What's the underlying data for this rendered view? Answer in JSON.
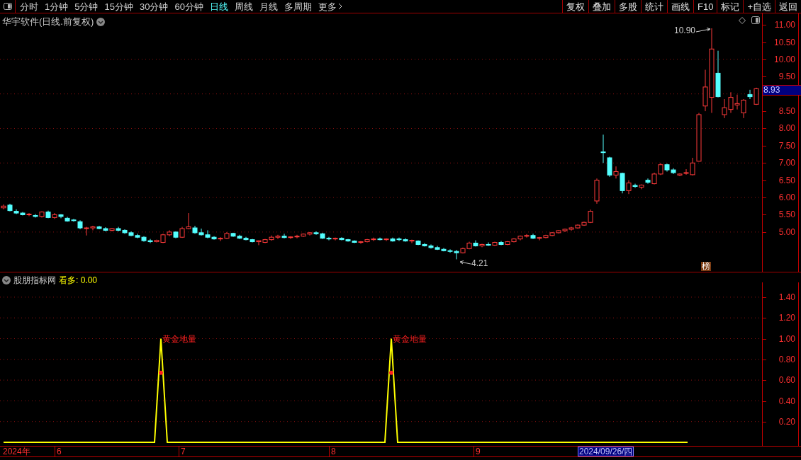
{
  "toolbar": {
    "periods": [
      {
        "label": "分时",
        "kind": "period",
        "selected": false
      },
      {
        "label": "1分钟",
        "kind": "period",
        "selected": false
      },
      {
        "label": "5分钟",
        "kind": "period",
        "selected": false
      },
      {
        "label": "15分钟",
        "kind": "period",
        "selected": false
      },
      {
        "label": "30分钟",
        "kind": "period",
        "selected": false
      },
      {
        "label": "60分钟",
        "kind": "period",
        "selected": false
      },
      {
        "label": "日线",
        "kind": "period",
        "selected": true
      },
      {
        "label": "周线",
        "kind": "period",
        "selected": false
      },
      {
        "label": "月线",
        "kind": "period",
        "selected": false
      },
      {
        "label": "多周期",
        "kind": "period",
        "selected": false
      },
      {
        "label": "更多",
        "kind": "menu",
        "selected": false
      }
    ],
    "buttons": [
      "复权",
      "叠加",
      "多股",
      "统计",
      "画线",
      "F10",
      "标记",
      "+自选",
      "返回"
    ]
  },
  "chart": {
    "title": "华宇软件(日线.前复权)",
    "current_price": "8.93",
    "high_label": "10.90",
    "low_label": "4.21",
    "badge": "榜",
    "chart_data": {
      "type": "candlestick",
      "grid": true,
      "ylim": [
        3.85,
        11.33
      ],
      "yticks": [
        {
          "value": 11,
          "label": "11.00"
        },
        {
          "value": 10.5,
          "label": "10.50"
        },
        {
          "value": 10,
          "label": "10.00"
        },
        {
          "value": 9.5,
          "label": "9.50"
        },
        {
          "value": 8.5,
          "label": "8.50"
        },
        {
          "value": 8,
          "label": "8.00"
        },
        {
          "value": 7.5,
          "label": "7.50"
        },
        {
          "value": 7,
          "label": "7.00"
        },
        {
          "value": 6.5,
          "label": "6.50"
        },
        {
          "value": 6,
          "label": "6.00"
        },
        {
          "value": 5.5,
          "label": "5.50"
        },
        {
          "value": 5,
          "label": "5.00"
        }
      ],
      "ohlc": [
        [
          5.7,
          5.8,
          5.66,
          5.75
        ],
        [
          5.78,
          5.82,
          5.6,
          5.62
        ],
        [
          5.6,
          5.66,
          5.52,
          5.55
        ],
        [
          5.55,
          5.58,
          5.48,
          5.5
        ],
        [
          5.5,
          5.55,
          5.46,
          5.52
        ],
        [
          5.48,
          5.52,
          5.42,
          5.45
        ],
        [
          5.45,
          5.6,
          5.42,
          5.58
        ],
        [
          5.58,
          5.62,
          5.4,
          5.42
        ],
        [
          5.42,
          5.55,
          5.38,
          5.5
        ],
        [
          5.5,
          5.52,
          5.4,
          5.45
        ],
        [
          5.4,
          5.44,
          5.3,
          5.32
        ],
        [
          5.35,
          5.38,
          5.3,
          5.34
        ],
        [
          5.3,
          5.34,
          5.08,
          5.12
        ],
        [
          5.1,
          5.15,
          4.9,
          5.12
        ],
        [
          5.12,
          5.18,
          5.05,
          5.15
        ],
        [
          5.15,
          5.18,
          5.08,
          5.1
        ],
        [
          5.1,
          5.14,
          5.02,
          5.05
        ],
        [
          5.05,
          5.12,
          5.02,
          5.1
        ],
        [
          5.1,
          5.15,
          5.02,
          5.05
        ],
        [
          5.05,
          5.08,
          4.95,
          4.98
        ],
        [
          4.98,
          5.02,
          4.88,
          4.9
        ],
        [
          4.9,
          4.95,
          4.82,
          4.85
        ],
        [
          4.85,
          4.88,
          4.72,
          4.75
        ],
        [
          4.75,
          4.8,
          4.68,
          4.72
        ],
        [
          4.72,
          4.78,
          4.7,
          4.76
        ],
        [
          4.7,
          4.95,
          4.68,
          4.92
        ],
        [
          4.92,
          5.05,
          4.88,
          5.0
        ],
        [
          5.0,
          5.02,
          4.82,
          4.85
        ],
        [
          4.85,
          5.15,
          4.83,
          5.1
        ],
        [
          5.1,
          5.55,
          5.08,
          5.15
        ],
        [
          5.12,
          5.18,
          4.95,
          4.98
        ],
        [
          4.98,
          5.1,
          4.9,
          4.92
        ],
        [
          4.92,
          5.05,
          4.82,
          4.85
        ],
        [
          4.85,
          4.88,
          4.78,
          4.8
        ],
        [
          4.8,
          4.85,
          4.74,
          4.82
        ],
        [
          4.82,
          5.0,
          4.8,
          4.96
        ],
        [
          4.96,
          4.98,
          4.86,
          4.88
        ],
        [
          4.88,
          4.92,
          4.8,
          4.82
        ],
        [
          4.82,
          4.86,
          4.76,
          4.78
        ],
        [
          4.78,
          4.8,
          4.7,
          4.72
        ],
        [
          4.72,
          4.76,
          4.62,
          4.75
        ],
        [
          4.7,
          4.8,
          4.68,
          4.78
        ],
        [
          4.78,
          4.9,
          4.75,
          4.85
        ],
        [
          4.85,
          4.92,
          4.8,
          4.88
        ],
        [
          4.88,
          4.95,
          4.82,
          4.84
        ],
        [
          4.84,
          4.88,
          4.8,
          4.86
        ],
        [
          4.86,
          4.92,
          4.82,
          4.88
        ],
        [
          4.88,
          4.96,
          4.86,
          4.94
        ],
        [
          4.94,
          5.0,
          4.9,
          4.98
        ],
        [
          4.98,
          5.02,
          4.92,
          4.95
        ],
        [
          4.95,
          4.98,
          4.8,
          4.82
        ],
        [
          4.82,
          4.86,
          4.76,
          4.8
        ],
        [
          4.8,
          4.84,
          4.76,
          4.82
        ],
        [
          4.82,
          4.85,
          4.76,
          4.78
        ],
        [
          4.78,
          4.8,
          4.72,
          4.74
        ],
        [
          4.74,
          4.76,
          4.68,
          4.7
        ],
        [
          4.7,
          4.74,
          4.66,
          4.72
        ],
        [
          4.72,
          4.8,
          4.7,
          4.78
        ],
        [
          4.78,
          4.84,
          4.74,
          4.8
        ],
        [
          4.8,
          4.84,
          4.76,
          4.78
        ],
        [
          4.78,
          4.82,
          4.74,
          4.8
        ],
        [
          4.8,
          4.84,
          4.72,
          4.74
        ],
        [
          4.8,
          4.84,
          4.74,
          4.78
        ],
        [
          4.78,
          4.82,
          4.72,
          4.74
        ],
        [
          4.74,
          4.78,
          4.68,
          4.76
        ],
        [
          4.74,
          4.76,
          4.62,
          4.64
        ],
        [
          4.64,
          4.68,
          4.58,
          4.6
        ],
        [
          4.6,
          4.64,
          4.52,
          4.55
        ],
        [
          4.55,
          4.6,
          4.48,
          4.5
        ],
        [
          4.5,
          4.54,
          4.44,
          4.46
        ],
        [
          4.46,
          4.5,
          4.4,
          4.44
        ],
        [
          4.44,
          4.48,
          4.21,
          4.4
        ],
        [
          4.4,
          4.55,
          4.38,
          4.52
        ],
        [
          4.52,
          4.72,
          4.5,
          4.68
        ],
        [
          4.68,
          4.76,
          4.58,
          4.6
        ],
        [
          4.6,
          4.66,
          4.56,
          4.64
        ],
        [
          4.64,
          4.7,
          4.6,
          4.62
        ],
        [
          4.62,
          4.72,
          4.6,
          4.7
        ],
        [
          4.7,
          4.74,
          4.62,
          4.64
        ],
        [
          4.64,
          4.74,
          4.62,
          4.72
        ],
        [
          4.72,
          4.82,
          4.7,
          4.8
        ],
        [
          4.8,
          4.9,
          4.76,
          4.88
        ],
        [
          4.88,
          4.94,
          4.84,
          4.9
        ],
        [
          4.9,
          4.95,
          4.8,
          4.82
        ],
        [
          4.82,
          4.86,
          4.76,
          4.84
        ],
        [
          4.84,
          4.92,
          4.82,
          4.9
        ],
        [
          4.9,
          5.0,
          4.88,
          4.98
        ],
        [
          4.98,
          5.05,
          4.96,
          5.04
        ],
        [
          5.04,
          5.1,
          5.0,
          5.08
        ],
        [
          5.08,
          5.15,
          5.04,
          5.12
        ],
        [
          5.12,
          5.22,
          5.1,
          5.2
        ],
        [
          5.2,
          5.3,
          5.18,
          5.28
        ],
        [
          5.28,
          5.65,
          5.26,
          5.6
        ],
        [
          5.9,
          6.55,
          5.82,
          6.5
        ],
        [
          7.32,
          7.82,
          7.0,
          7.3
        ],
        [
          7.15,
          7.18,
          6.6,
          6.65
        ],
        [
          6.65,
          6.9,
          6.55,
          6.75
        ],
        [
          6.7,
          6.72,
          6.12,
          6.2
        ],
        [
          6.2,
          6.5,
          6.1,
          6.42
        ],
        [
          6.35,
          6.4,
          6.28,
          6.32
        ],
        [
          6.3,
          6.38,
          6.24,
          6.36
        ],
        [
          6.5,
          6.55,
          6.4,
          6.44
        ],
        [
          6.4,
          6.72,
          6.38,
          6.68
        ],
        [
          6.68,
          7.0,
          6.65,
          6.95
        ],
        [
          6.95,
          6.98,
          6.75,
          6.8
        ],
        [
          6.8,
          6.85,
          6.68,
          6.72
        ],
        [
          6.65,
          6.7,
          6.62,
          6.68
        ],
        [
          6.7,
          6.82,
          6.66,
          6.72
        ],
        [
          6.66,
          7.15,
          6.64,
          7.0
        ],
        [
          7.05,
          8.45,
          7.04,
          8.4
        ],
        [
          8.65,
          9.7,
          8.5,
          9.2
        ],
        [
          8.9,
          10.9,
          8.45,
          10.3
        ],
        [
          9.6,
          10.25,
          8.9,
          8.92
        ],
        [
          8.4,
          8.85,
          8.3,
          8.6
        ],
        [
          8.55,
          9.05,
          8.45,
          8.9
        ],
        [
          8.68,
          8.98,
          8.55,
          8.72
        ],
        [
          8.45,
          8.85,
          8.3,
          8.82
        ],
        [
          8.98,
          9.12,
          8.85,
          8.92
        ],
        [
          8.7,
          9.18,
          8.68,
          9.15
        ]
      ]
    }
  },
  "indicator": {
    "name": "股朋指标网",
    "reading_label": "看多: 0.00",
    "signal_labels": [
      "黄金地量",
      "黄金地量"
    ],
    "axis": [
      "1.40",
      "1.20",
      "1.00",
      "0.80",
      "0.60",
      "0.40",
      "0.20"
    ]
  },
  "time_axis": {
    "labels": [
      "2024年",
      "6",
      "7",
      "8",
      "9"
    ],
    "cursor_date": "2024/09/26/四"
  }
}
